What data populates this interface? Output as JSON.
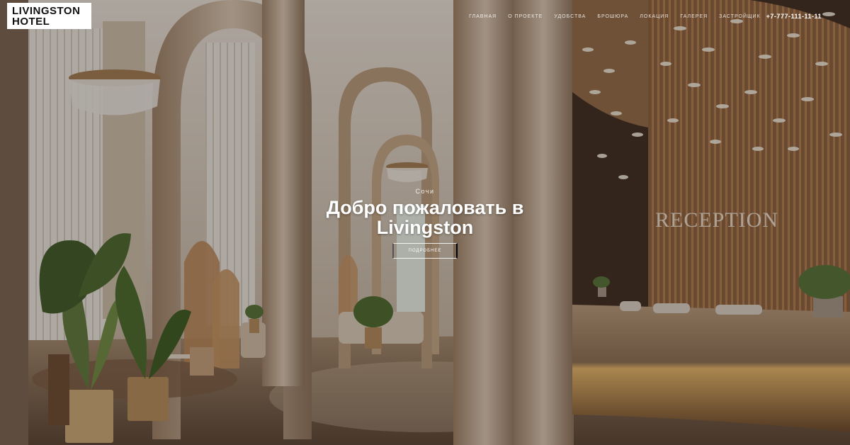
{
  "brand": {
    "line1": "LIVINGSTON",
    "line2": "HOTEL"
  },
  "nav": {
    "items": [
      "ГЛАВНАЯ",
      "О ПРОЕКТЕ",
      "УДОБСТВА",
      "БРОШЮРА",
      "ЛОКАЦИЯ",
      "ГАЛЕРЕЯ",
      "ЗАСТРОЙЩИК"
    ],
    "phone": "+7-777-111-11-11"
  },
  "hero": {
    "city": "Сочи",
    "title_line1": "Добро пожаловать в",
    "title_line2": "Livingston",
    "button_label": "ПОДРОБНЕЕ"
  },
  "background": {
    "sign_text": "RECEPTION"
  },
  "colors": {
    "logo_bg": "#ffffff",
    "logo_text": "#111111",
    "text": "#ffffff",
    "wood": "#8a6a4a",
    "marble": "#c9b49a"
  }
}
